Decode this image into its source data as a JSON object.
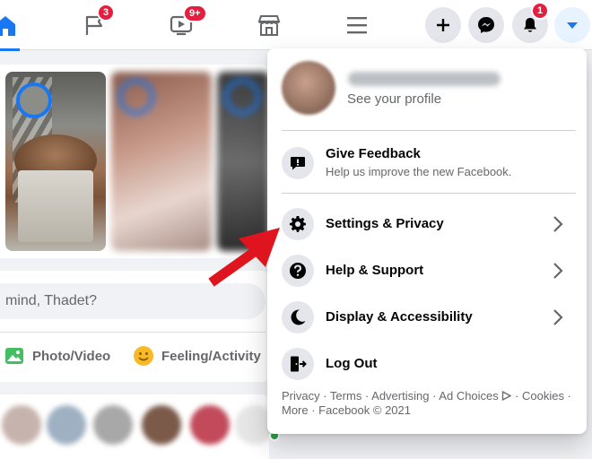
{
  "nav": {
    "tabs": [
      {
        "name": "home",
        "icon": "home-icon",
        "badge": ""
      },
      {
        "name": "pages",
        "icon": "flag-icon",
        "badge": "3"
      },
      {
        "name": "watch",
        "icon": "video-icon",
        "badge": "9+"
      },
      {
        "name": "marketplace",
        "icon": "store-icon",
        "badge": ""
      },
      {
        "name": "menu",
        "icon": "hamburger-icon",
        "badge": ""
      }
    ],
    "actions": [
      {
        "name": "create",
        "icon": "plus-icon",
        "badge": ""
      },
      {
        "name": "messenger",
        "icon": "messenger-icon",
        "badge": ""
      },
      {
        "name": "notifications",
        "icon": "bell-icon",
        "badge": "1"
      },
      {
        "name": "account",
        "icon": "caret-down-icon",
        "badge": ""
      }
    ]
  },
  "composer": {
    "placeholder": "mind, Thadet?",
    "photo_video": "Photo/Video",
    "feeling_activity": "Feeling/Activity"
  },
  "menu": {
    "profile_subtitle": "See your profile",
    "feedback": {
      "title": "Give Feedback",
      "subtitle": "Help us improve the new Facebook."
    },
    "items": [
      {
        "label": "Settings & Privacy",
        "icon": "gear-icon"
      },
      {
        "label": "Help & Support",
        "icon": "question-icon"
      },
      {
        "label": "Display & Accessibility",
        "icon": "moon-icon"
      },
      {
        "label": "Log Out",
        "icon": "logout-icon"
      }
    ],
    "footer_line1": "Privacy · Terms · Advertising · Ad Choices",
    "footer_line1b": " · Cookies ·",
    "footer_line2": "More · Facebook © 2021"
  },
  "colors": {
    "brand_blue": "#1877f2",
    "badge_red": "#e41e3f",
    "arrow_red": "#e0141e",
    "online_green": "#31a24c"
  }
}
